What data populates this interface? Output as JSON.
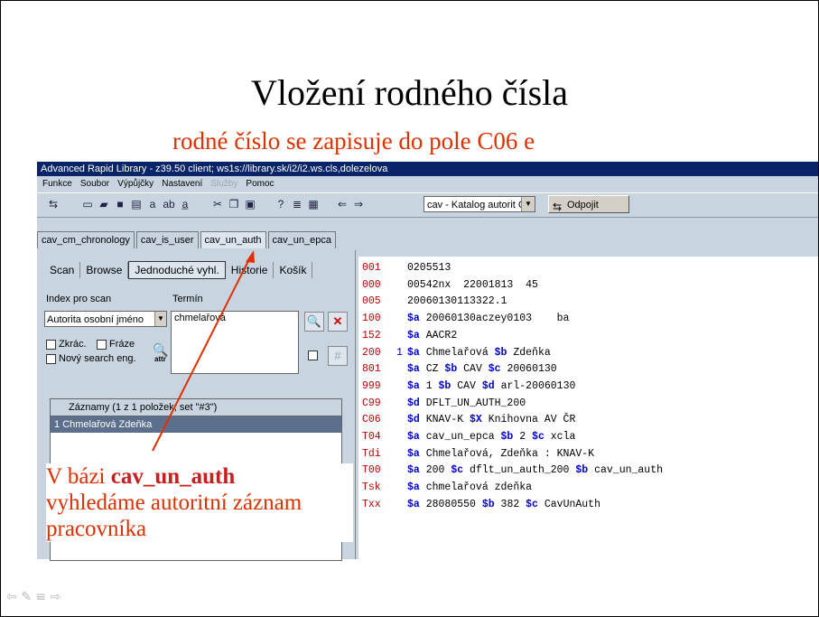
{
  "slide": {
    "title": "Vložení rodného čísla",
    "subtitle": "rodné číslo se zapisuje do pole C06 e"
  },
  "window": {
    "title": "Advanced Rapid Library - z39.50 client; ws1s://library.sk/i2/i2.ws.cls,dolezelova"
  },
  "menu": [
    "Funkce",
    "Soubor",
    "Výpůjčky",
    "Nastavení",
    "Služby",
    "Pomoc"
  ],
  "toolbar": {
    "catalog_select": "cav - Katalog autorit C",
    "disconnect_label": "Odpojit"
  },
  "tabs": [
    "cav_cm_chronology",
    "cav_is_user",
    "cav_un_auth",
    "cav_un_epca"
  ],
  "active_tab": "cav_un_auth",
  "search": {
    "subtabs": [
      "Scan",
      "Browse",
      "Jednoduché vyhl.",
      "Historie",
      "Košík"
    ],
    "index_label": "Index pro scan",
    "term_label": "Termín",
    "index_value": "Autorita osobní jméno",
    "term_value": "chmelařová",
    "opt_zkrac": "Zkrác.",
    "opt_fraze": "Fráze",
    "opt_new_engine": "Nový search eng.",
    "attr_label": "attr"
  },
  "results": {
    "header": "Záznamy (1 z 1 položek, set \"#3\")",
    "row_num": "1",
    "row_text": "Chmelařová Zdeňka"
  },
  "record": [
    {
      "tag": "001",
      "ind": "",
      "val": "0205513"
    },
    {
      "tag": "000",
      "ind": "",
      "val": "00542nx  22001813  45"
    },
    {
      "tag": "005",
      "ind": "",
      "val": "20060130113322.1"
    },
    {
      "tag": "100",
      "ind": "",
      "val": "$a 20060130aczey0103    ba"
    },
    {
      "tag": "152",
      "ind": "",
      "val": "$a AACR2"
    },
    {
      "tag": "200",
      "ind": "1",
      "val": "$a Chmelařová $b Zdeňka"
    },
    {
      "tag": "801",
      "ind": "",
      "val": "$a CZ $b CAV $c 20060130"
    },
    {
      "tag": "999",
      "ind": "",
      "val": "$a 1 $b CAV $d arl-20060130"
    },
    {
      "tag": "C99",
      "ind": "",
      "val": "$d DFLT_UN_AUTH_200"
    },
    {
      "tag": "C06",
      "ind": "",
      "val": "$d KNAV-K $X Knihovna AV ČR"
    },
    {
      "tag": "T04",
      "ind": "",
      "val": "$a cav_un_epca $b 2 $c xcla"
    },
    {
      "tag": "Tdi",
      "ind": "",
      "val": "$a Chmelařová, Zdeňka : KNAV-K"
    },
    {
      "tag": "T00",
      "ind": "",
      "val": "$a 200 $c dflt_un_auth_200 $b cav_un_auth"
    },
    {
      "tag": "Tsk",
      "ind": "",
      "val": "$a chmelařová zdeňka"
    },
    {
      "tag": "Txx",
      "ind": "",
      "val": "$a 28080550 $b 382 $c CavUnAuth"
    }
  ],
  "annotation": {
    "prefix": "V bázi ",
    "bold": "cav_un_auth",
    "rest": "vyhledáme autoritní záznam pracovníka"
  },
  "colors": {
    "annotation": "#e03000",
    "tag": "#c00000",
    "titlebar": "#0a246a"
  }
}
